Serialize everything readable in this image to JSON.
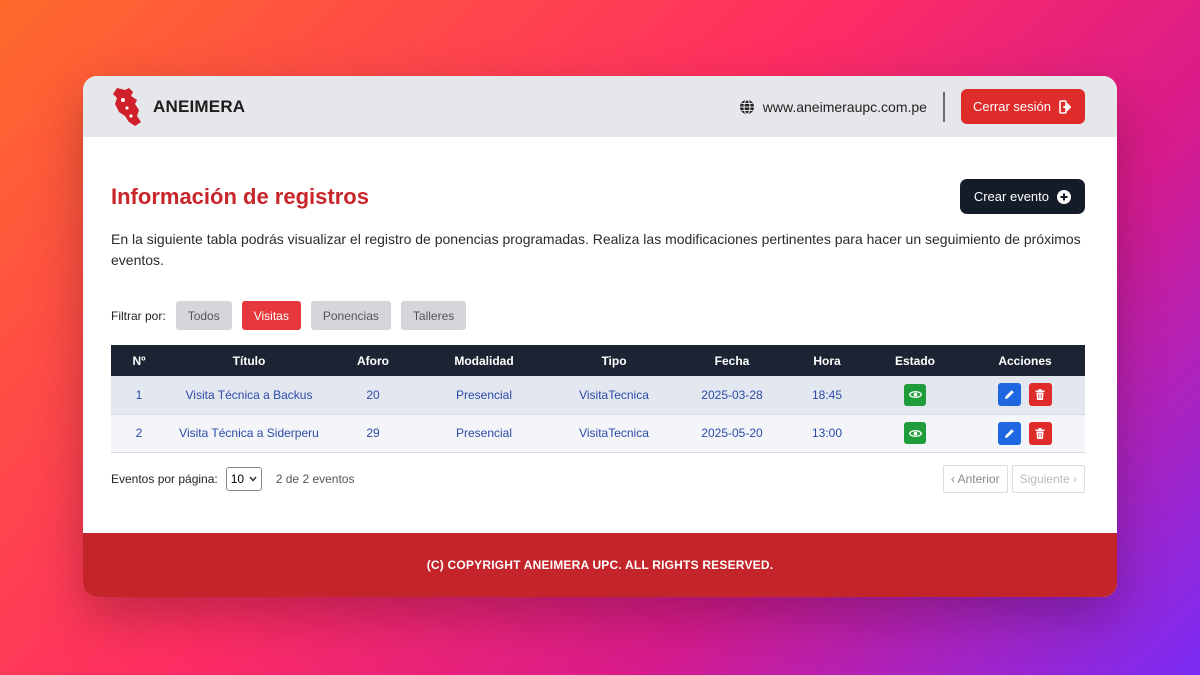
{
  "header": {
    "brand": "ANEIMERA",
    "website": "www.aneimeraupc.com.pe",
    "logout_label": "Cerrar sesión"
  },
  "main": {
    "title": "Información de registros",
    "create_label": "Crear evento",
    "description": "En la siguiente tabla podrás visualizar el registro de ponencias programadas. Realiza las modificaciones pertinentes para hacer un seguimiento de próximos eventos."
  },
  "filters": {
    "label": "Filtrar por:",
    "options": [
      "Todos",
      "Visitas",
      "Ponencias",
      "Talleres"
    ],
    "active": "Visitas"
  },
  "table": {
    "columns": [
      "Nº",
      "Título",
      "Aforo",
      "Modalidad",
      "Tipo",
      "Fecha",
      "Hora",
      "Estado",
      "Acciones"
    ],
    "rows": [
      {
        "n": "1",
        "titulo": "Visita Técnica a Backus",
        "aforo": "20",
        "modalidad": "Presencial",
        "tipo": "VisitaTecnica",
        "fecha": "2025-03-28",
        "hora": "18:45"
      },
      {
        "n": "2",
        "titulo": "Visita Técnica a Siderperu",
        "aforo": "29",
        "modalidad": "Presencial",
        "tipo": "VisitaTecnica",
        "fecha": "2025-05-20",
        "hora": "13:00"
      }
    ]
  },
  "pagination": {
    "per_page_label": "Eventos por página:",
    "per_page_value": "10",
    "count_text": "2 de 2 eventos",
    "prev_label": "Anterior",
    "next_label": "Siguiente"
  },
  "footer": {
    "text": "(C) COPYRIGHT ANEIMERA UPC. ALL RIGHTS RESERVED."
  },
  "colors": {
    "accent_red": "#e02b2b",
    "dark": "#1c2433",
    "link_blue": "#2c4aa8",
    "status_green": "#1f9d3a"
  }
}
